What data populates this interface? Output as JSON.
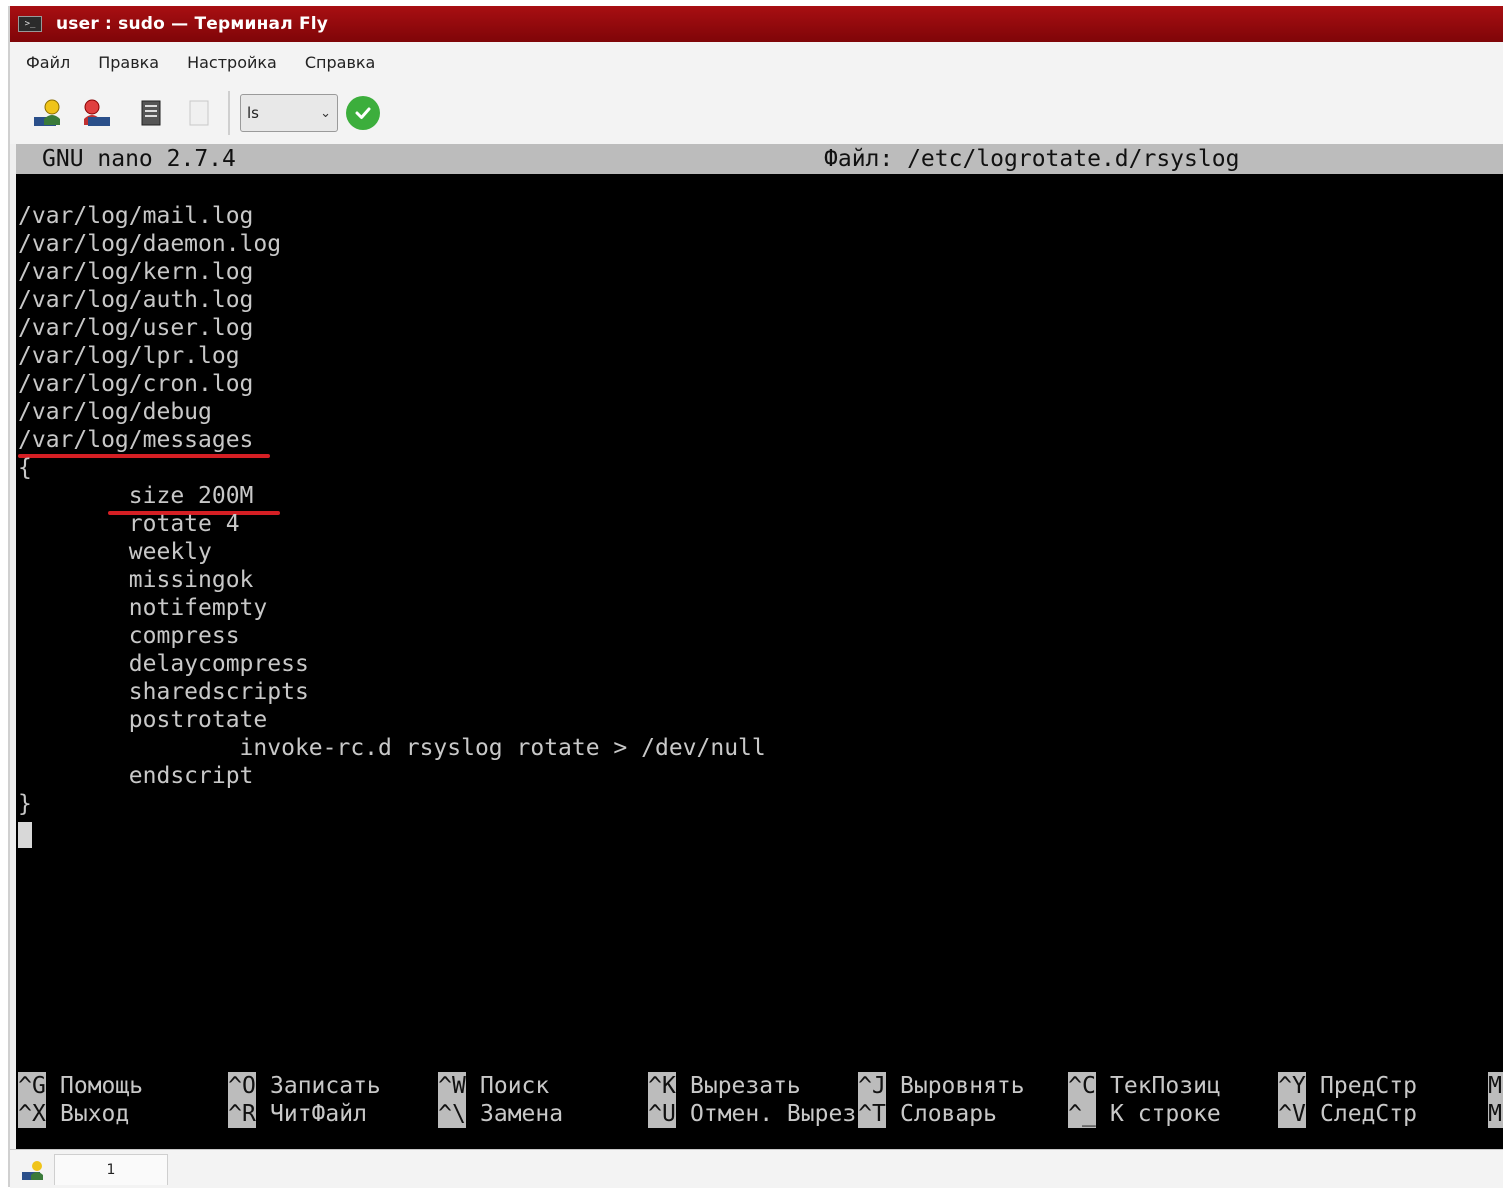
{
  "window": {
    "title": "user : sudo — Терминал Fly",
    "icon": "terminal-icon"
  },
  "menu": {
    "items": [
      "Файл",
      "Правка",
      "Настройка",
      "Справка"
    ]
  },
  "toolbar": {
    "buttons": [
      {
        "icon": "user-connect-icon"
      },
      {
        "icon": "user-disconnect-icon"
      },
      {
        "icon": "copy-icon"
      },
      {
        "icon": "paste-icon"
      }
    ],
    "command_value": "ls",
    "run_icon": "green-check-icon"
  },
  "nano": {
    "program": "GNU nano 2.7.4",
    "file": "Файл: /etc/logrotate.d/rsyslog",
    "lines": [
      "/var/log/mail.log",
      "/var/log/daemon.log",
      "/var/log/kern.log",
      "/var/log/auth.log",
      "/var/log/user.log",
      "/var/log/lpr.log",
      "/var/log/cron.log",
      "/var/log/debug",
      "/var/log/messages",
      "{",
      "        size 200M",
      "        rotate 4",
      "        weekly",
      "        missingok",
      "        notifempty",
      "        compress",
      "        delaycompress",
      "        sharedscripts",
      "        postrotate",
      "                invoke-rc.d rsyslog rotate > /dev/null",
      "        endscript",
      "}"
    ],
    "highlight_color": "#d51f24",
    "shortcuts": [
      {
        "k1": "^G",
        "l1": "Помощь",
        "k2": "^X",
        "l2": "Выход"
      },
      {
        "k1": "^O",
        "l1": "Записать",
        "k2": "^R",
        "l2": "ЧитФайл"
      },
      {
        "k1": "^W",
        "l1": "Поиск",
        "k2": "^\\",
        "l2": "Замена"
      },
      {
        "k1": "^K",
        "l1": "Вырезать",
        "k2": "^U",
        "l2": "Отмен. Вырез"
      },
      {
        "k1": "^J",
        "l1": "Выровнять",
        "k2": "^T",
        "l2": "Словарь"
      },
      {
        "k1": "^C",
        "l1": "ТекПозиц",
        "k2": "^_",
        "l2": "К строке"
      },
      {
        "k1": "^Y",
        "l1": "ПредСтр",
        "k2": "^V",
        "l2": "СледСтр"
      },
      {
        "k1": "M-",
        "l1": "",
        "k2": "M-",
        "l2": ""
      }
    ]
  },
  "statusbar": {
    "tab_label": "1",
    "icon": "session-icon"
  }
}
